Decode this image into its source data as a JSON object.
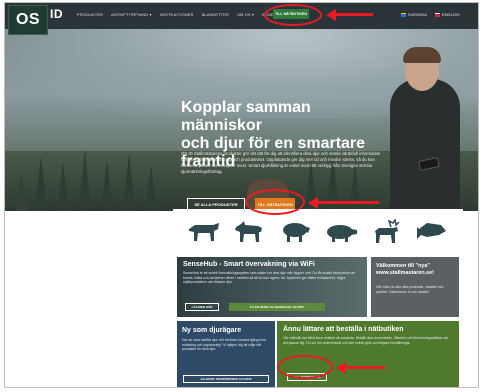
{
  "header": {
    "logo_os": "OS",
    "logo_id": "ID",
    "nav": [
      {
        "label": "PRODUKTER"
      },
      {
        "label": "ANTIKPTITRFNING ▾"
      },
      {
        "label": "INSTRUKTIONER"
      },
      {
        "label": "BLANKETTER"
      },
      {
        "label": "OM OS ▾"
      },
      {
        "label": "KUNDTJÄNST"
      }
    ],
    "cta_label": "TILL NÄTBUTIKEN",
    "languages": [
      {
        "label": "SVENSKA"
      },
      {
        "label": "ENGLISH"
      }
    ]
  },
  "hero": {
    "title_line1": "Kopplar samman människor",
    "title_line2": "och djur för en smartare",
    "title_line3": "framtid",
    "body": "OS ID Stallmästarens produkter gör det lätt för dig att identifiera dina djur och samla värdefull information om djurhälsa, härstamning och produktivitet. Oppfattande ger dig mer tid och mindre stress, så du kan fokusera på det som betyder mest. Smart djurhållning är enkel med rätt verktyg från Sveriges största djurmärkningsföretag.",
    "btn_products": "SE ALLA PRODUKTER",
    "btn_shop": "TILL NÄTBUTIKEN"
  },
  "animals": [
    {
      "icon": "cow-icon"
    },
    {
      "icon": "goat-icon"
    },
    {
      "icon": "sheep-icon"
    },
    {
      "icon": "pig-icon"
    },
    {
      "icon": "reindeer-icon"
    },
    {
      "icon": "fish-icon"
    }
  ],
  "cards": {
    "sense": {
      "title": "SenseHub - Smart övervakning via WiFi",
      "text": "SenseHub är ett enkelt övervakningssystem som mäter hur dina djur mår dygnet runt. Du får snabb information om brunst, hälsa och avvikelser direkt i mobilen så att du kan agera i tid. Systemet ger bättre fruktsamhet, högre mjölkproduktion och friskare djur.",
      "btn_more": "LÄS MER HÄR",
      "btn_sense": "FÅ EN DEMO AV SENSEHUB VIA WIFI"
    },
    "stall": {
      "title": "Välkommen till \"nya\" www.stallmastaren.se!",
      "text": "Här hittar du alla våra produkter, rabatter och nyheter. Välkommen in och handla!"
    },
    "new": {
      "title": "Ny som djurägare",
      "text": "Har du nyss skaffat djur och behöver komma igång med märkning och registrering? Vi hjälper dig att välja rätt produkter för dina djur.",
      "btn_label": "ALLMÄNT OM MÄRKNING AV DJUR"
    },
    "easy": {
      "title": "Ännu lättare att beställa i nätbutiken",
      "text": "Vår nätbutik har blivit ännu enklare att använda. Beställ dina öronmärken, tillbehör och förbrukningsartiklar när det passar dig. Du ser din orderhistorik och kan enkelt göra om tidigare beställningar.",
      "btn_label": "TILL NÄTBUTIKEN"
    }
  },
  "colors": {
    "annotation": "#e81b23",
    "shop_button": "#e0781c",
    "header_bg": "#2b3539",
    "card_green": "#4f7a2e",
    "card_blue": "#2f4a66"
  }
}
